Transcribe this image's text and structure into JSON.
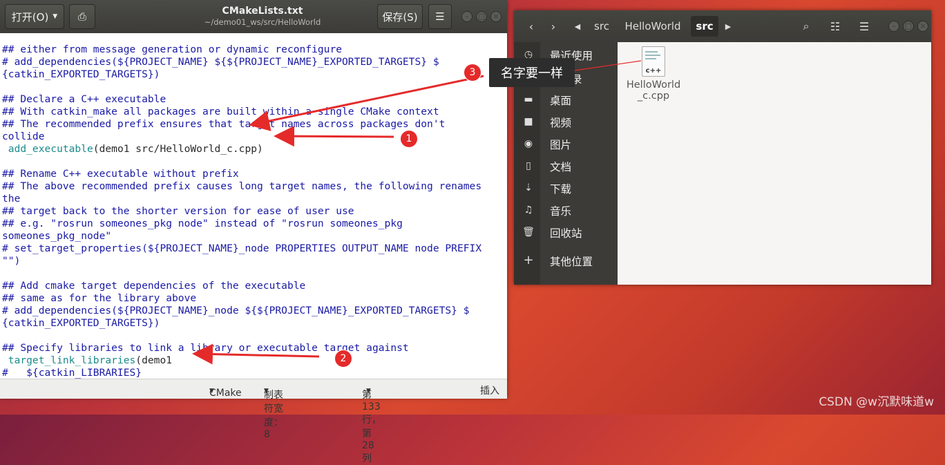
{
  "editor": {
    "open_label": "打开(O)",
    "title": "CMakeLists.txt",
    "subtitle": "~/demo01_ws/src/HelloWorld",
    "save_label": "保存(S)",
    "code_lines": [
      "## either from message generation or dynamic reconfigure",
      "# add_dependencies(${PROJECT_NAME} ${${PROJECT_NAME}_EXPORTED_TARGETS} $",
      "{catkin_EXPORTED_TARGETS})",
      "",
      "## Declare a C++ executable",
      "## With catkin_make all packages are built within a single CMake context",
      "## The recommended prefix ensures that target names across packages don't",
      "collide",
      "",
      "",
      "## Rename C++ executable without prefix",
      "## The above recommended prefix causes long target names, the following renames",
      "the",
      "## target back to the shorter version for ease of user use",
      "## e.g. \"rosrun someones_pkg node\" instead of \"rosrun someones_pkg",
      "someones_pkg_node\"",
      "# set_target_properties(${PROJECT_NAME}_node PROPERTIES OUTPUT_NAME node PREFIX",
      "\"\")",
      "",
      "## Add cmake target dependencies of the executable",
      "## same as for the library above",
      "# add_dependencies(${PROJECT_NAME}_node ${${PROJECT_NAME}_EXPORTED_TARGETS} $",
      "{catkin_EXPORTED_TARGETS})",
      "",
      "## Specify libraries to link a library or executable target against",
      "",
      "#   ${catkin_LIBRARIES}",
      "# )"
    ],
    "add_exec_fn": " add_executable",
    "add_exec_args": "(demo1 src/HelloWorld_c.cpp)",
    "link_fn": " target_link_libraries",
    "link_args": "(demo1",
    "status": {
      "language": "CMake",
      "tab_width": "制表符宽度：8",
      "position": "第 133 行，第 28 列",
      "insert_mode": "插入"
    }
  },
  "file_manager": {
    "path": [
      "src",
      "HelloWorld",
      "src"
    ],
    "sidebar": [
      {
        "icon": "recent-icon",
        "label": "最近使用"
      },
      {
        "icon": "home-icon",
        "label": "主目录"
      },
      {
        "icon": "folder-icon",
        "label": "桌面"
      },
      {
        "icon": "video-icon",
        "label": "视频"
      },
      {
        "icon": "camera-icon",
        "label": "图片"
      },
      {
        "icon": "document-icon",
        "label": "文档"
      },
      {
        "icon": "download-icon",
        "label": "下载"
      },
      {
        "icon": "music-icon",
        "label": "音乐"
      },
      {
        "icon": "trash-icon",
        "label": "回收站"
      },
      {
        "icon": "plus-icon",
        "label": "其他位置"
      }
    ],
    "file": {
      "name_line1": "HelloWorld",
      "name_line2": "_c.cpp",
      "icon_text": "c++"
    }
  },
  "annotations": {
    "badge1": "1",
    "badge2": "2",
    "badge3": "3",
    "tooltip": "名字要一样"
  },
  "watermark": "CSDN @w沉默味道w",
  "colors": {
    "arrow": "#e52a2a",
    "code_comment": "#1a1aa6",
    "code_function": "#1a8b8b"
  }
}
